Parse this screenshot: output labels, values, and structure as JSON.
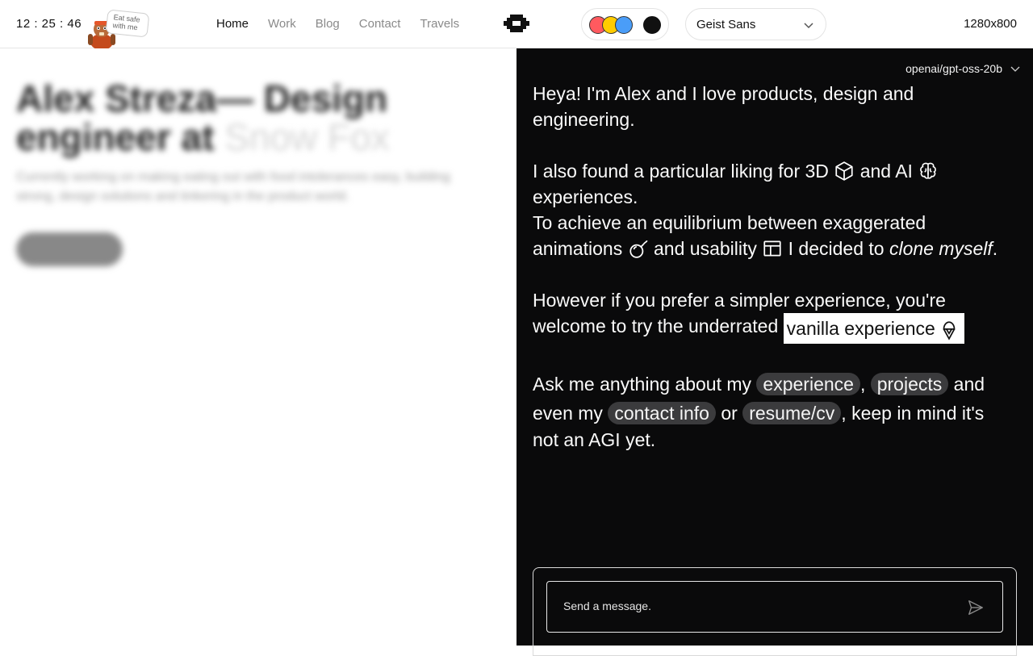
{
  "header": {
    "clock": "12 : 25 : 46",
    "sticker_text": "Eat safe with me",
    "nav": [
      {
        "label": "Home",
        "active": true
      },
      {
        "label": "Work",
        "active": false
      },
      {
        "label": "Blog",
        "active": false
      },
      {
        "label": "Contact",
        "active": false
      },
      {
        "label": "Travels",
        "active": false
      }
    ],
    "theme_colors": [
      "#ff5a5f",
      "#ffcc00",
      "#4a9df8",
      "#111111"
    ],
    "font_select": "Geist Sans",
    "resolution": "1280x800"
  },
  "hero": {
    "title_strong": "Alex Streza— Design engineer at ",
    "title_soft": "Snow Fox",
    "subtitle": "Currently working on making eating out with food intolerances easy, building strong, design solutions and tinkering in the product world."
  },
  "chat": {
    "model": "openai/gpt-oss-20b",
    "intro": "Heya! I'm Alex and I love products, design and engineering.",
    "line2_a": "I also found a particular liking for 3D",
    "line2_b": "and AI",
    "line2_c": "experiences.",
    "line3_a": "To achieve an equilibrium between exaggerated animations",
    "line3_b": "and usability",
    "line3_c": "I decided to",
    "line3_em": "clone myself",
    "line3_d": ".",
    "line4": "However if you prefer a simpler experience, you're welcome to try the underrated",
    "vanilla_label": "vanilla experience",
    "ask_a": "Ask me anything about my",
    "chip_experience": "experience",
    "ask_comma": ",",
    "chip_projects": "projects",
    "ask_b": "and even my",
    "chip_contact": "contact info",
    "ask_or": "or",
    "chip_resume": "resume/cv",
    "ask_c": ", keep in mind it's",
    "ask_d": "not an AGI yet.",
    "input_placeholder": "Send a message."
  }
}
